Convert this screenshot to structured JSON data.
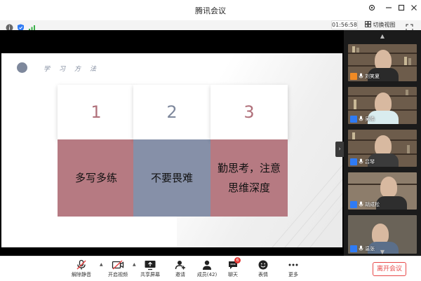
{
  "window": {
    "title": "腾讯会议",
    "controls": [
      "settings",
      "minimize",
      "maximize",
      "close"
    ]
  },
  "infobar": {
    "timer": "01:56:58",
    "switch_view": "切换视图",
    "signal_color": "#3cb14a",
    "shield_color": "#2f7bf4"
  },
  "slide": {
    "heading": "学习方法",
    "cards": [
      {
        "number": "1",
        "text": "多写多练",
        "number_color": "#b0707a",
        "body_color": "#b67a82"
      },
      {
        "number": "2",
        "text": "不要畏难",
        "number_color": "#7e889c",
        "body_color": "#8690a8"
      },
      {
        "number": "3",
        "text": "勤思考，注意思维深度",
        "number_color": "#b0707a",
        "body_color": "#b67a82"
      }
    ]
  },
  "participants": [
    {
      "name": "刘笑夏",
      "host": true
    },
    {
      "name": "吴皓",
      "host": false
    },
    {
      "name": "吕琴",
      "host": false
    },
    {
      "name": "胡成松",
      "host": false
    },
    {
      "name": "温张",
      "host": false
    }
  ],
  "toolbar": {
    "items": [
      {
        "id": "mute",
        "label": "解除静音"
      },
      {
        "id": "video",
        "label": "开启视频"
      },
      {
        "id": "share",
        "label": "共享屏幕"
      },
      {
        "id": "invite",
        "label": "邀请"
      },
      {
        "id": "members",
        "label": "成员(42)"
      },
      {
        "id": "chat",
        "label": "聊天",
        "badge": "6"
      },
      {
        "id": "emoji",
        "label": "表情"
      },
      {
        "id": "more",
        "label": "更多"
      }
    ],
    "leave": "离开会议",
    "accent": "#e84848"
  }
}
